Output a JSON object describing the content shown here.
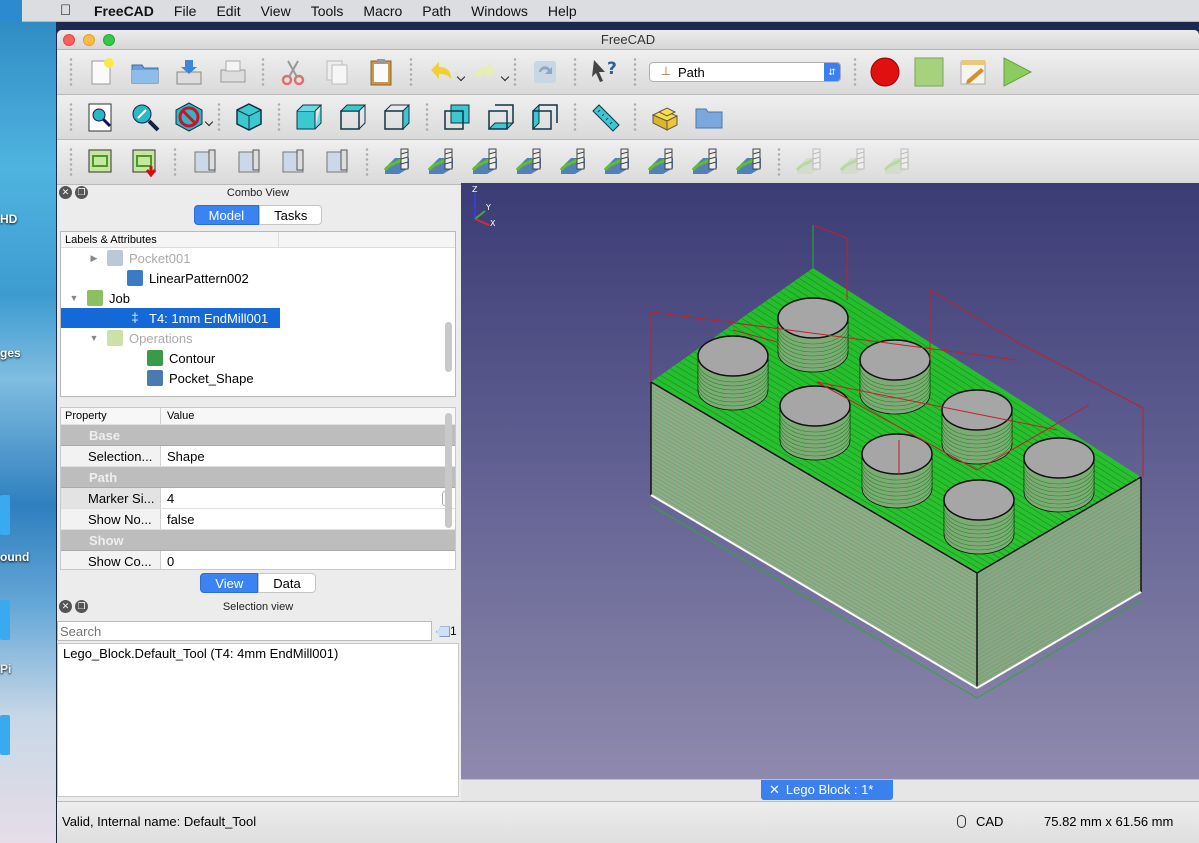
{
  "menubar": {
    "app_name": "FreeCAD",
    "items": [
      "File",
      "Edit",
      "View",
      "Tools",
      "Macro",
      "Path",
      "Windows",
      "Help"
    ]
  },
  "desktop": {
    "labels": [
      "HD",
      "ges",
      "ound",
      "Pi"
    ]
  },
  "window": {
    "title": "FreeCAD"
  },
  "toolbar": {
    "row1": [
      "new-document",
      "open-document",
      "save-document",
      "print",
      "cut",
      "copy",
      "paste",
      "undo",
      "redo",
      "refresh",
      "whats-this"
    ],
    "workbench": "Path",
    "macro": [
      "record-macro",
      "stop-macro",
      "edit-macro",
      "execute-macro"
    ],
    "row2": [
      "fit-all",
      "fit-selection",
      "draw-style",
      "isometric-view",
      "front-view",
      "top-view",
      "right-view",
      "rear-view",
      "bottom-view",
      "left-view",
      "measure-distance",
      "create-part",
      "create-group"
    ],
    "row3": [
      "path-job",
      "post-process",
      "tool-controller",
      "tool-library",
      "tool-bits",
      "stock",
      "profile",
      "pocket-shape",
      "pocket-3d",
      "face-mill",
      "drilling",
      "engrave",
      "adaptive",
      "helix",
      "deburr",
      "vcarve",
      "waterline",
      "slot"
    ]
  },
  "combo_view": {
    "title": "Combo View",
    "tabs": [
      {
        "label": "Model",
        "active": true
      },
      {
        "label": "Tasks",
        "active": false
      }
    ],
    "tree_header": "Labels & Attributes",
    "tree": [
      {
        "label": "Pocket001",
        "dim": true,
        "indent": 2,
        "arrow": "right"
      },
      {
        "label": "LinearPattern002",
        "dim": false,
        "indent": 3,
        "arrow": ""
      },
      {
        "label": "Job",
        "dim": false,
        "indent": 1,
        "arrow": "down"
      },
      {
        "label": "T4: 1mm EndMill001",
        "dim": false,
        "indent": 3,
        "arrow": "",
        "selected": true
      },
      {
        "label": "Operations",
        "dim": true,
        "indent": 2,
        "arrow": "down"
      },
      {
        "label": "Contour",
        "dim": false,
        "indent": 4,
        "arrow": ""
      },
      {
        "label": "Pocket_Shape",
        "dim": false,
        "indent": 4,
        "arrow": ""
      }
    ],
    "property_header": {
      "property": "Property",
      "value": "Value"
    },
    "properties": [
      {
        "type": "group",
        "name": "Base"
      },
      {
        "type": "item",
        "name": "Selection...",
        "value": "Shape"
      },
      {
        "type": "group",
        "name": "Path"
      },
      {
        "type": "item",
        "name": "Marker Si...",
        "value": "4",
        "spin": true
      },
      {
        "type": "item",
        "name": "Show No...",
        "value": "false"
      },
      {
        "type": "group",
        "name": "Show"
      },
      {
        "type": "item",
        "name": "Show Co...",
        "value": "0"
      }
    ],
    "bottom_tabs": [
      {
        "label": "View",
        "active": true
      },
      {
        "label": "Data",
        "active": false
      }
    ]
  },
  "selection_view": {
    "title": "Selection view",
    "search_placeholder": "Search",
    "count": "1",
    "items": [
      "Lego_Block.Default_Tool (T4: 4mm EndMill001)"
    ]
  },
  "viewport": {
    "axis_labels": {
      "x": "X",
      "y": "Y",
      "z": "Z"
    },
    "colors": {
      "toolpath": "#1fd11f",
      "rapid": "#c0202a",
      "bg_top": "#3c3c75",
      "bg_bottom": "#8f8aad"
    }
  },
  "document_tab": {
    "label": "Lego Block : 1*"
  },
  "status": {
    "message": "Valid, Internal name: Default_Tool",
    "nav_style": "CAD",
    "dimensions": "75.82 mm x 61.56 mm"
  }
}
